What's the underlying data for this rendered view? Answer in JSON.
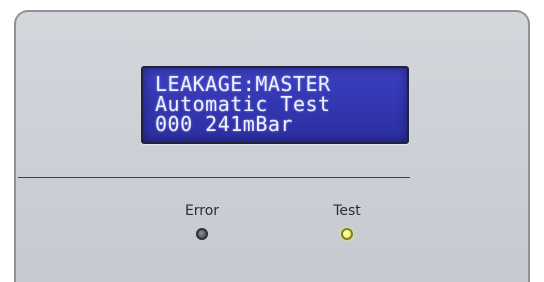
{
  "display": {
    "line1": "LEAKAGE:MASTER",
    "line2": "Automatic Test",
    "line3": "000 241mBar"
  },
  "indicators": [
    {
      "label": "Error",
      "state": "off",
      "color": "#5c5f64"
    },
    {
      "label": "Test",
      "state": "on",
      "color": "#f5f56a"
    }
  ],
  "colors": {
    "panel": "#cfd3d8",
    "lcd_background": "#3336b0",
    "lcd_text": "#eef0ff"
  }
}
